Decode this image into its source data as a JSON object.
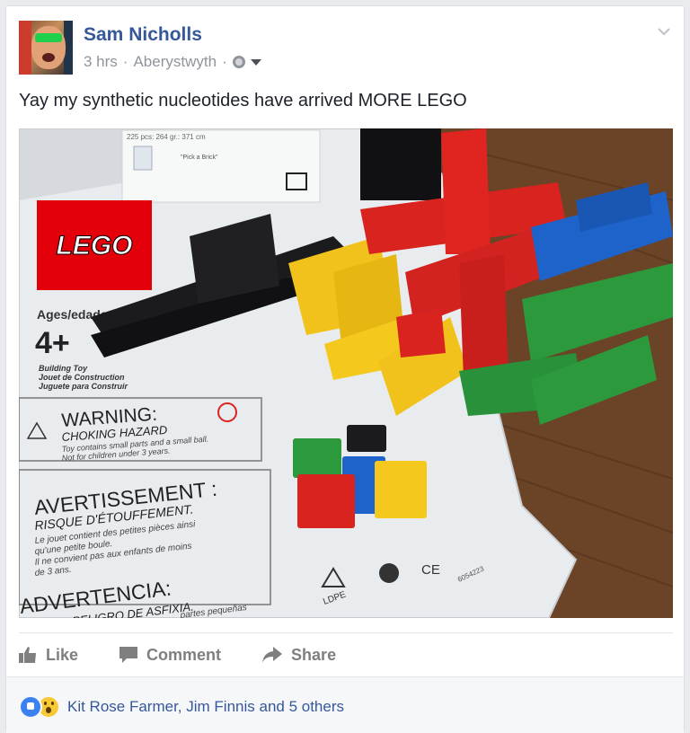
{
  "post": {
    "author": "Sam Nicholls",
    "time": "3 hrs",
    "separator1": "·",
    "location": "Aberystwyth",
    "separator2": "·",
    "audience_icon": "globe-icon",
    "text": "Yay my synthetic nucleotides have arrived MORE LEGO"
  },
  "photo": {
    "bag_label_top": "225 pcs: 264 gr.: 371 cm",
    "pick_a_brick": "\"Pick a Brick\"",
    "lego_logo": "LEGO",
    "ages_label": "Ages/edades",
    "age_value": "4+",
    "building_toy": "Building Toy",
    "jouet": "Jouet de Construction",
    "juguete": "Juguete para Construir",
    "warning_title": "WARNING:",
    "warning_sub": "CHOKING HAZARD",
    "warning_body_1": "Toy contains small parts and a small ball.",
    "warning_body_2": "Not for children under 3 years.",
    "avert_title": "AVERTISSEMENT :",
    "avert_sub": "RISQUE D'ÉTOUFFEMENT.",
    "avert_body_1": "Le jouet contient des petites pièces ainsi",
    "avert_body_2": "qu'une petite boule.",
    "avert_body_3": "Il ne convient pas aux enfants de moins",
    "avert_body_4": "de 3 ans.",
    "adv_title": "ADVERTENCIA:",
    "adv_sub": "PELIGRO DE ASFIXIA.",
    "adv_body": "partes pequeñas",
    "recycle_label": "LDPE",
    "ce_mark": "CE",
    "code": "6054223"
  },
  "actions": {
    "like": "Like",
    "comment": "Comment",
    "share": "Share"
  },
  "reactions": {
    "text": "Kit Rose Farmer, Jim Finnis and 5 others"
  },
  "colors": {
    "link": "#365899",
    "meta": "#90949c",
    "lego_red": "#e3000b",
    "brick_red": "#d8231f",
    "brick_yellow": "#f4c81c",
    "brick_blue": "#1e63c9",
    "brick_green": "#2c9a3c",
    "brick_black": "#1b1b1e"
  }
}
